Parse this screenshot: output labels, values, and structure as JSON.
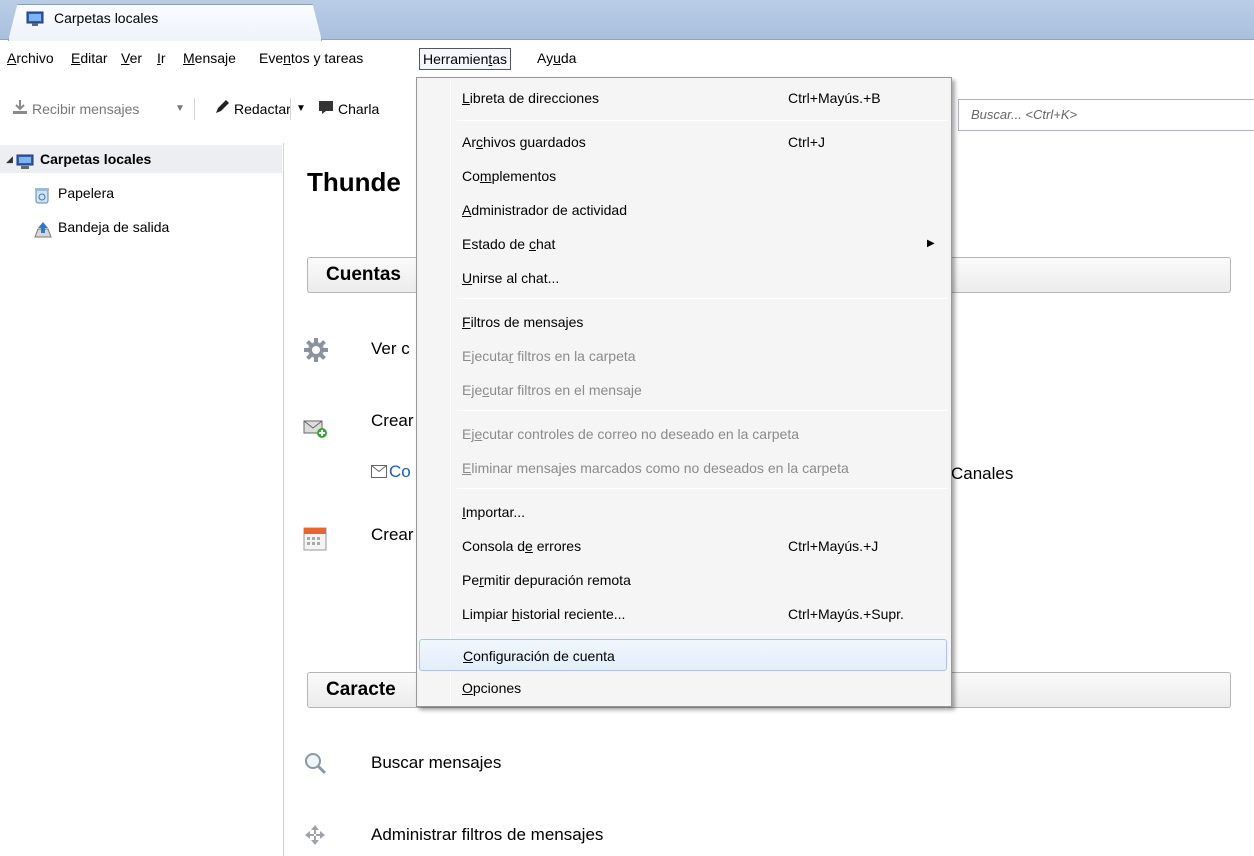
{
  "window": {
    "tab_title": "Carpetas locales"
  },
  "menubar": {
    "archivo": "Archivo",
    "editar": "Editar",
    "ver": "Ver",
    "ir": "Ir",
    "mensaje": "Mensaje",
    "eventos": "Eventos y tareas",
    "herramientas": "Herramientas",
    "ayuda": "Ayuda"
  },
  "toolbar": {
    "get_messages": "Recibir mensajes",
    "write": "Redactar",
    "chat": "Charla",
    "search_placeholder": "Buscar... <Ctrl+K>"
  },
  "sidebar": {
    "root": "Carpetas locales",
    "items": [
      "Papelera",
      "Bandeja de salida"
    ]
  },
  "main": {
    "title": "Thunde",
    "accounts_header": "Cuentas",
    "view_settings": "Ver c",
    "create_account": "Crear",
    "email_link": "Co",
    "feeds": "Canales",
    "create_calendar": "Crear",
    "features_header": "Caracte",
    "search_messages": "Buscar mensajes",
    "manage_filters": "Administrar filtros de mensajes"
  },
  "tools_menu": {
    "address_book": "Libreta de direcciones",
    "address_book_key": "Ctrl+Mayús.+B",
    "saved_files": "Archivos guardados",
    "saved_files_key": "Ctrl+J",
    "addons": "Complementos",
    "activity_manager": "Administrador de actividad",
    "chat_status": "Estado de chat",
    "join_chat": "Unirse al chat...",
    "message_filters": "Filtros de mensajes",
    "run_filters_folder": "Ejecutar filtros en la carpeta",
    "run_filters_message": "Ejecutar filtros en el mensaje",
    "run_junk_controls": "Ejecutar controles de correo no deseado en la carpeta",
    "delete_junk": "Eliminar mensajes marcados como no deseados en la carpeta",
    "import": "Importar...",
    "error_console": "Consola de errores",
    "error_console_key": "Ctrl+Mayús.+J",
    "remote_debug": "Permitir depuración remota",
    "clear_history": "Limpiar historial reciente...",
    "clear_history_key": "Ctrl+Mayús.+Supr.",
    "account_settings": "Configuración de cuenta",
    "options": "Opciones"
  },
  "colors": {
    "accent": "#1a5fb4",
    "menu_highlight": "#e3eefb",
    "tabbar": "#b9cde5"
  },
  "icons": [
    "thunderbird-folder-icon",
    "trash-icon",
    "outbox-icon",
    "gear-icon",
    "new-account-icon",
    "calendar-icon",
    "envelope-icon",
    "search-icon",
    "filter-icon",
    "pencil-icon",
    "chat-icon",
    "download-icon"
  ]
}
